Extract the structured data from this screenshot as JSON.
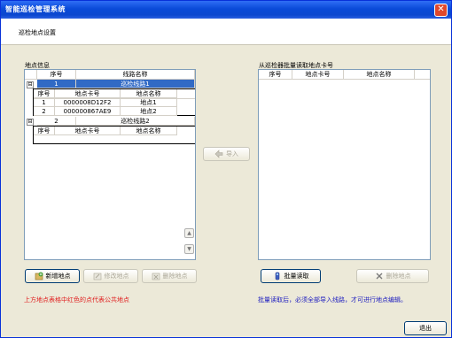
{
  "window": {
    "title": "智能巡检管理系统",
    "close_glyph": "✕"
  },
  "header": {
    "title": "巡检地点设置"
  },
  "left": {
    "label": "地点信息",
    "columns": [
      "序号",
      "线路名称"
    ],
    "routes": [
      {
        "no": "1",
        "name": "巡检线路1",
        "expander": "⊟",
        "sub_columns": [
          "序号",
          "地点卡号",
          "地点名称"
        ],
        "points": [
          {
            "no": "1",
            "card": "0000008D12F2",
            "name": "地点1"
          },
          {
            "no": "2",
            "card": "000000867AE9",
            "name": "地点2"
          }
        ]
      },
      {
        "no": "2",
        "name": "巡检线路2",
        "expander": "⊟",
        "sub_columns": [
          "序号",
          "地点卡号",
          "地点名称"
        ],
        "points": []
      }
    ],
    "buttons": {
      "add": "新增地点",
      "edit": "修改地点",
      "delete": "删除地点"
    },
    "note": "上方地点表格中红色的点代表公共地点"
  },
  "middle": {
    "import": "导入"
  },
  "right": {
    "label": "从巡检器批量读取地点卡号",
    "columns": [
      "序号",
      "地点卡号",
      "地点名称"
    ],
    "buttons": {
      "read": "批量读取",
      "delete": "删除地点"
    },
    "note": "批量读取后，必须全部导入线路，才可进行地点编辑。"
  },
  "footer": {
    "exit": "退出"
  }
}
